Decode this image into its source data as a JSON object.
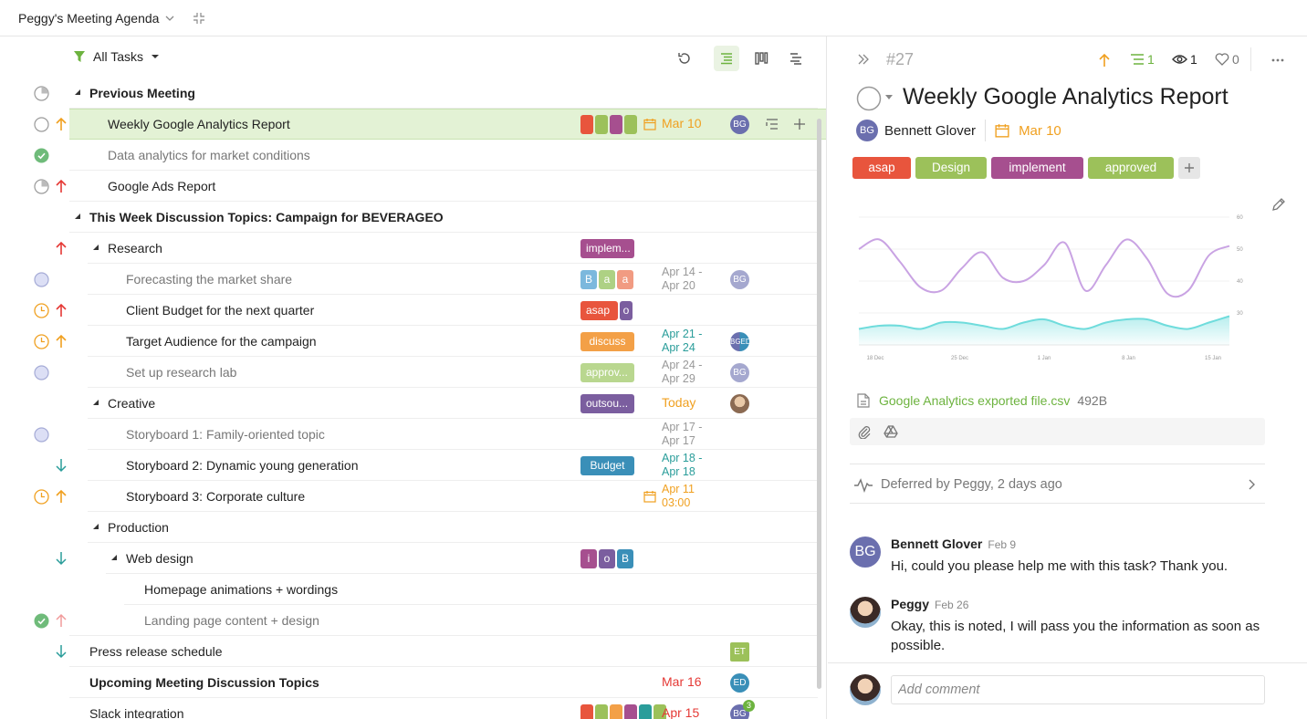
{
  "project": {
    "title": "Peggy's Meeting Agenda"
  },
  "toolbar": {
    "filter_label": "All Tasks"
  },
  "colors": {
    "accent_green": "#6db33f",
    "orange": "#f0a020",
    "red": "#e53935",
    "teal": "#2a9d9a"
  },
  "tasks": [
    {
      "title": "Previous Meeting"
    },
    {
      "title": "Weekly Google Analytics Report",
      "date": "Mar 10",
      "avatar": "BG"
    },
    {
      "title": "Data analytics for market conditions"
    },
    {
      "title": "Google Ads Report"
    },
    {
      "title": "This Week Discussion Topics: Campaign for BEVERAGEO"
    },
    {
      "title": "Research",
      "tags": [
        "implem..."
      ]
    },
    {
      "title": "Forecasting the market share",
      "tags": [
        "B",
        "a",
        "a"
      ],
      "date1": "Apr 14 -",
      "date2": "Apr 20",
      "avatar": "BG"
    },
    {
      "title": "Client Budget for the next quarter",
      "tags": [
        "asap",
        "o"
      ]
    },
    {
      "title": "Target Audience for the campaign",
      "tags": [
        "discuss"
      ],
      "date1": "Apr 21 -",
      "date2": "Apr 24",
      "avatar": "BGED"
    },
    {
      "title": "Set up research lab",
      "tags": [
        "approv..."
      ],
      "date1": "Apr 24 -",
      "date2": "Apr 29",
      "avatar": "BG"
    },
    {
      "title": "Creative",
      "tags": [
        "outsou..."
      ],
      "date": "Today"
    },
    {
      "title": "Storyboard 1: Family-oriented topic",
      "date1": "Apr 17 -",
      "date2": "Apr 17"
    },
    {
      "title": "Storyboard 2: Dynamic young generation",
      "tags": [
        "Budget"
      ],
      "date1": "Apr 18 -",
      "date2": "Apr 18"
    },
    {
      "title": "Storyboard 3: Corporate culture",
      "date1": "Apr 11",
      "date2": "03:00"
    },
    {
      "title": "Production"
    },
    {
      "title": "Web design",
      "tags": [
        "i",
        "o",
        "B"
      ]
    },
    {
      "title": "Homepage animations + wordings"
    },
    {
      "title": "Landing page content + design"
    },
    {
      "title": "Press release schedule",
      "avatar": "ET"
    },
    {
      "title": "Upcoming Meeting Discussion Topics",
      "date": "Mar 16",
      "avatar": "ED"
    },
    {
      "title": "Slack integration",
      "date": "Apr 15",
      "avatar": "BG",
      "badge": "3"
    }
  ],
  "detail": {
    "id": "#27",
    "subtask_count": "1",
    "watchers": "1",
    "likes": "0",
    "title": "Weekly Google Analytics Report",
    "assignee_initials": "BG",
    "assignee_name": "Bennett Glover",
    "due": "Mar 10",
    "tags": [
      "asap",
      "Design",
      "implement",
      "approved"
    ],
    "attachment_name": "Google Analytics exported file.csv",
    "attachment_size": "492B",
    "activity": "Deferred by Peggy, 2 days ago",
    "comments": [
      {
        "initials": "BG",
        "name": "Bennett Glover",
        "date": "Feb 9",
        "text": "Hi, could you please help me with this task? Thank you."
      },
      {
        "name": "Peggy",
        "date": "Feb 26",
        "text": "Okay, this is noted, I will pass you the information as soon as possible."
      }
    ],
    "comment_placeholder": "Add comment"
  },
  "chart_data": {
    "type": "area",
    "x_ticks": [
      "18 Dec",
      "25 Dec",
      "1 Jan",
      "8 Jan",
      "15 Jan"
    ],
    "y_ticks": [
      30,
      40,
      50,
      60
    ],
    "ylim": [
      20,
      60
    ],
    "series": [
      {
        "values": [
          50,
          53,
          46,
          38,
          37,
          44,
          49,
          41,
          40,
          45,
          52,
          37,
          45,
          53,
          47,
          36,
          37,
          48,
          51
        ]
      },
      {
        "values": [
          25,
          26,
          26,
          25,
          27,
          27,
          26,
          25,
          27,
          28,
          26,
          25,
          27,
          28,
          28,
          26,
          25,
          27,
          29
        ]
      }
    ]
  }
}
